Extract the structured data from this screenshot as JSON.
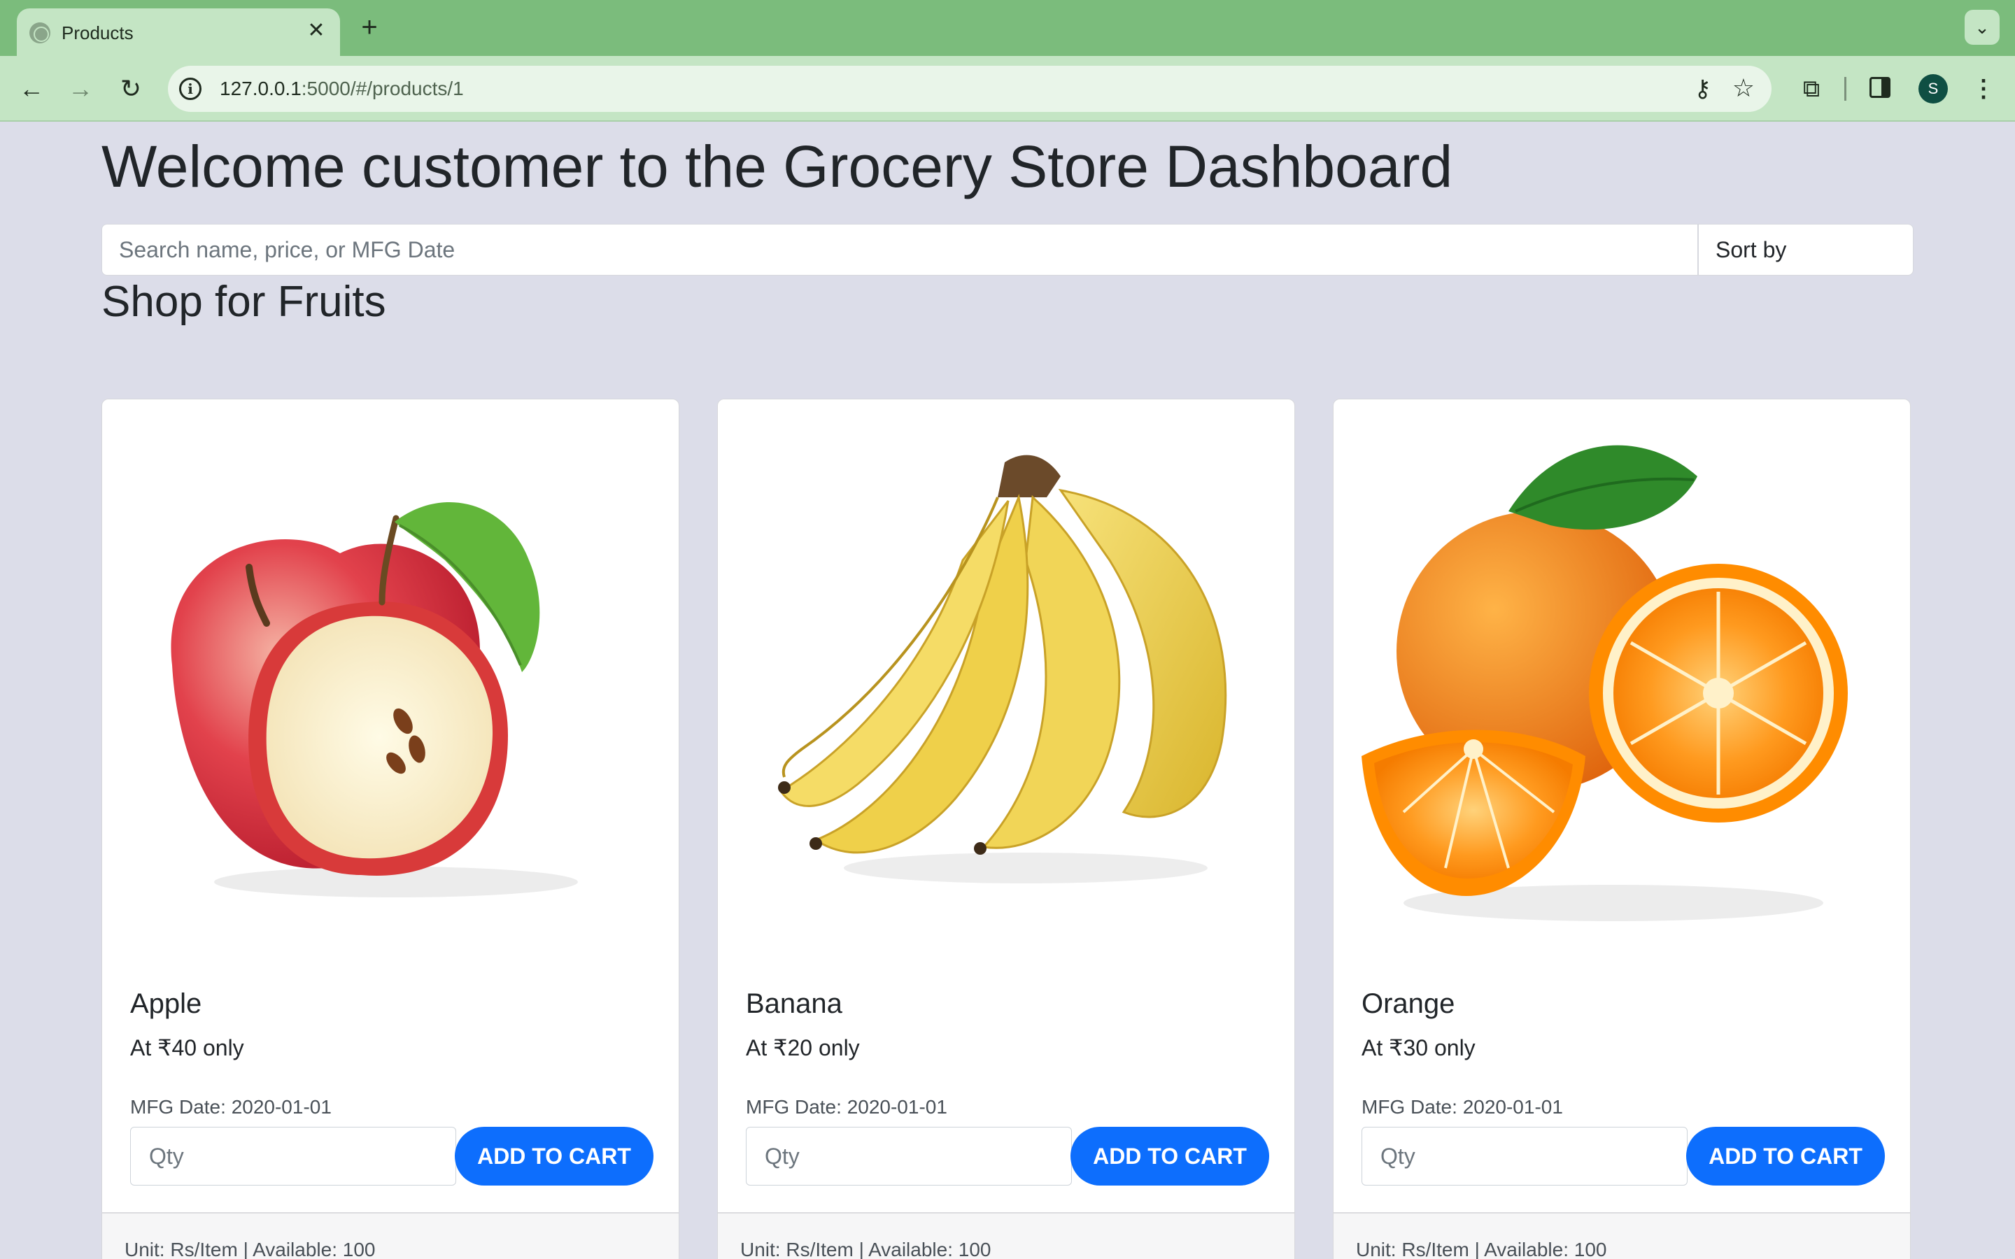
{
  "browser": {
    "tab_title": "Products",
    "tab_close_glyph": "✕",
    "new_tab_glyph": "+",
    "tab_menu_glyph": "⌄",
    "url_host": "127.0.0.1",
    "url_path": ":5000/#/products/1",
    "icons": [
      "back-icon",
      "forward-icon",
      "reload-icon",
      "site-info-icon",
      "password-key-icon",
      "bookmark-star-icon",
      "extensions-icon",
      "side-panel-icon",
      "profile-avatar",
      "kebab-menu-icon"
    ],
    "back_glyph": "←",
    "forward_glyph": "→",
    "reload_glyph": "↻",
    "info_glyph": "i",
    "key_glyph": "⚷",
    "star_glyph": "☆",
    "extensions_glyph": "⧉",
    "menu_glyph": "⋮",
    "avatar_letter": "S"
  },
  "page": {
    "title": "Welcome customer to the Grocery Store Dashboard",
    "search": {
      "placeholder": "Search name, price, or MFG Date"
    },
    "sort": {
      "selected": "Sort by"
    },
    "section_title": "Shop for Fruits"
  },
  "colors": {
    "accent": "#0d6efd",
    "browser_frame": "#7bbc7c",
    "page_background": "#dcdde9"
  },
  "products": [
    {
      "name": "Apple",
      "price": "At ₹40 only",
      "mfg": "MFG Date: 2020-01-01",
      "qty_placeholder": "Qty",
      "button": "ADD TO CART",
      "footer": "Unit: Rs/Item | Available: 100",
      "image": "apple-image"
    },
    {
      "name": "Banana",
      "price": "At ₹20 only",
      "mfg": "MFG Date: 2020-01-01",
      "qty_placeholder": "Qty",
      "button": "ADD TO CART",
      "footer": "Unit: Rs/Item | Available: 100",
      "image": "banana-image"
    },
    {
      "name": "Orange",
      "price": "At ₹30 only",
      "mfg": "MFG Date: 2020-01-01",
      "qty_placeholder": "Qty",
      "button": "ADD TO CART",
      "footer": "Unit: Rs/Item | Available: 100",
      "image": "orange-image"
    }
  ]
}
